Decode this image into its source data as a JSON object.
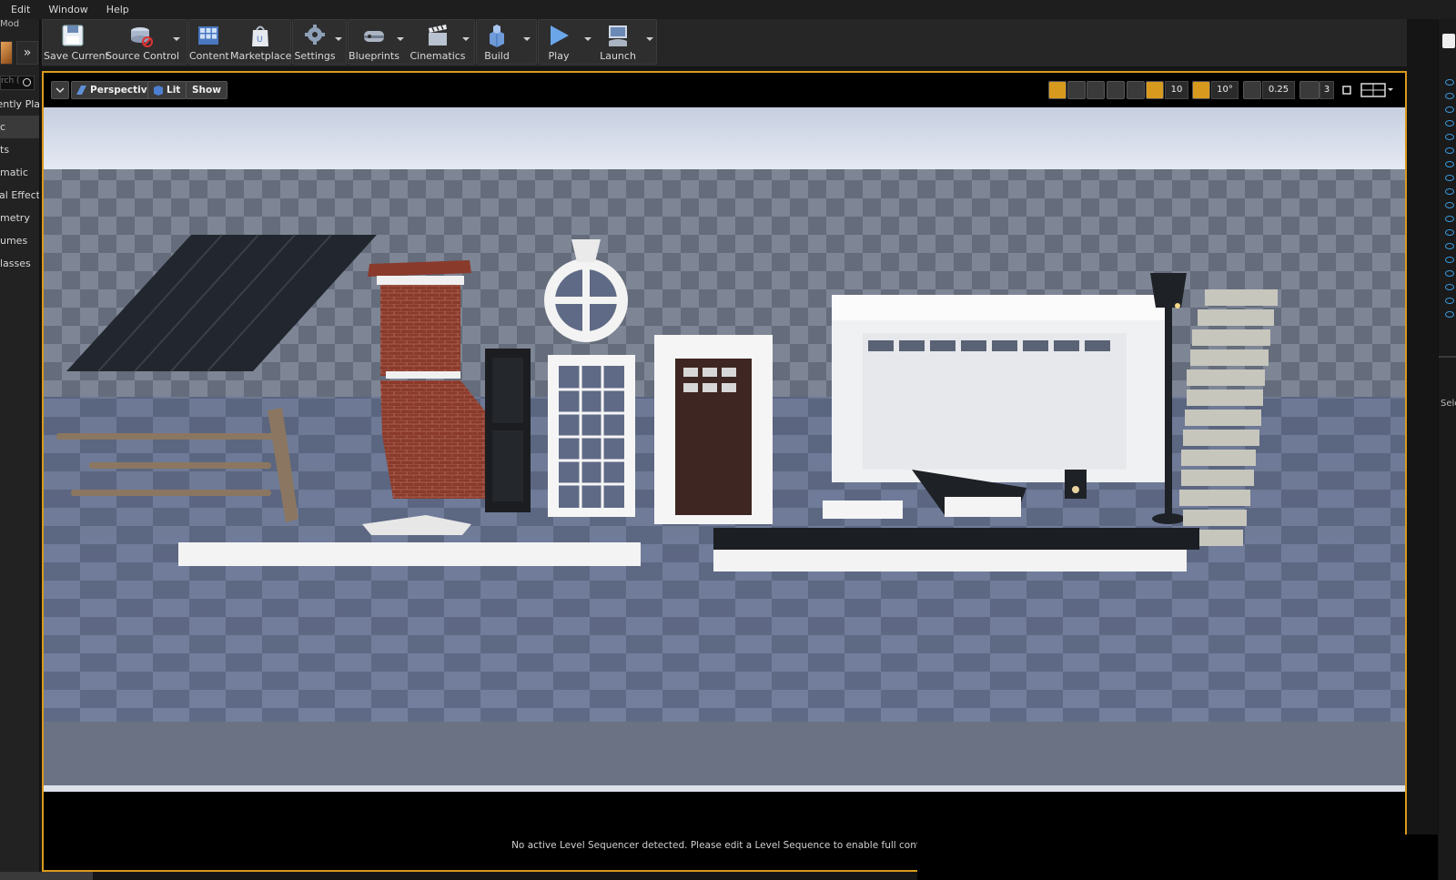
{
  "menubar": {
    "items": [
      "Edit",
      "Window",
      "Help"
    ]
  },
  "left_panel": {
    "mode_label": "Mod",
    "search_placeholder": "rch (",
    "categories": [
      {
        "label": "ently Pla",
        "active": false
      },
      {
        "label": "c",
        "active": true
      },
      {
        "label": "ts",
        "active": false
      },
      {
        "label": "matic",
        "active": false
      },
      {
        "label": "al Effect",
        "active": false
      },
      {
        "label": "metry",
        "active": false
      },
      {
        "label": "umes",
        "active": false
      },
      {
        "label": "lasses",
        "active": false
      }
    ]
  },
  "toolbar": {
    "save_current": "Save Current",
    "source_control": "Source Control",
    "content": "Content",
    "marketplace": "Marketplace",
    "settings": "Settings",
    "blueprints": "Blueprints",
    "cinematics": "Cinematics",
    "build": "Build",
    "play": "Play",
    "launch": "Launch"
  },
  "viewport": {
    "perspective": "Perspective",
    "lit": "Lit",
    "show": "Show",
    "grid_snap": "10",
    "rotation_snap": "10°",
    "scale_snap": "0.25",
    "camera_speed": "3",
    "accent_color": "#d89a1e"
  },
  "status": {
    "message": "No active Level Sequencer detected. Please edit a Level Sequence to enable full controls"
  },
  "right_panel": {
    "selected_label": "Sele"
  }
}
